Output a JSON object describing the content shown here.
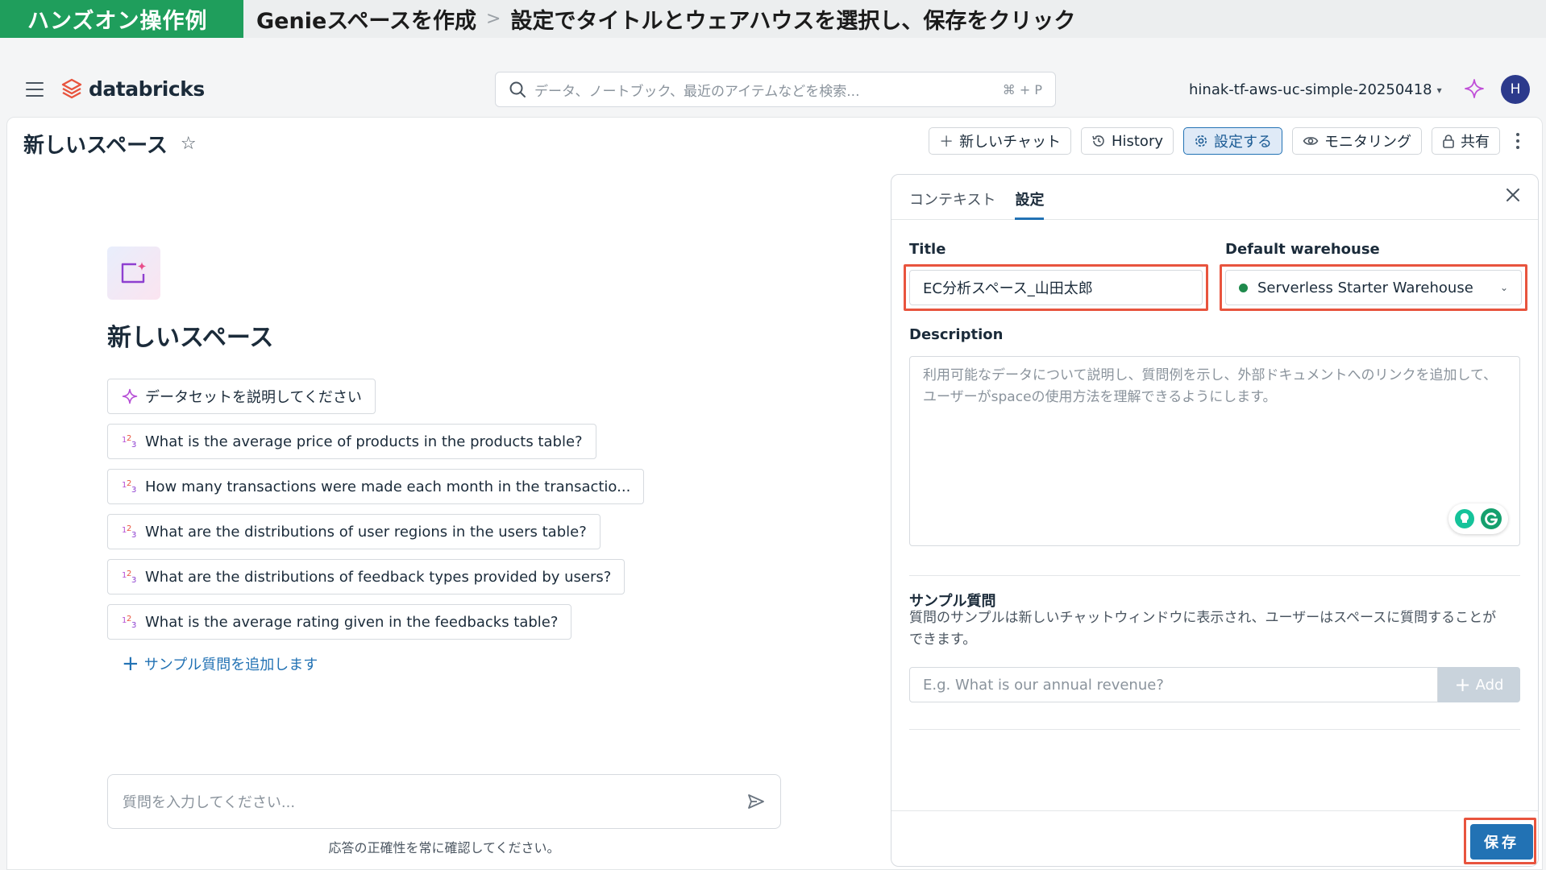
{
  "banner": {
    "tag": "ハンズオン操作例",
    "title": "Genieスペースを作成",
    "separator": ">",
    "step": "設定でタイトルとウェアハウスを選択し、保存をクリック"
  },
  "nav": {
    "logo_text": "databricks",
    "search_placeholder": "データ、ノートブック、最近のアイテムなどを検索...",
    "search_shortcut": "⌘ + P",
    "workspace": "hinak-tf-aws-uc-simple-20250418",
    "avatar_initial": "H"
  },
  "page": {
    "title": "新しいスペース"
  },
  "toolbar": {
    "new_chat": "新しいチャット",
    "history": "History",
    "settings": "設定する",
    "monitoring": "モニタリング",
    "share": "共有"
  },
  "chat": {
    "heading": "新しいスペース",
    "suggestions": [
      "データセットを説明してください",
      "What is the average price of products in the products table?",
      "How many transactions were made each month in the transactio...",
      "What are the distributions of user regions in the users table?",
      "What are the distributions of feedback types provided by users?",
      "What is the average rating given in the feedbacks table?"
    ],
    "add_sample": "サンプル質問を追加します",
    "input_placeholder": "質問を入力してください...",
    "disclaimer": "応答の正確性を常に確認してください。"
  },
  "panel": {
    "tabs": [
      "コンテキスト",
      "設定"
    ],
    "title_label": "Title",
    "title_value": "EC分析スペース_山田太郎",
    "warehouse_label": "Default warehouse",
    "warehouse_value": "Serverless Starter Warehouse",
    "description_label": "Description",
    "description_placeholder": "利用可能なデータについて説明し、質問例を示し、外部ドキュメントへのリンクを追加して、ユーザーがspaceの使用方法を理解できるようにします。",
    "sample_questions_label": "サンプル質問",
    "sample_questions_help": "質問のサンプルは新しいチャットウィンドウに表示され、ユーザーはスペースに質問することができます。",
    "sample_input_placeholder": "E.g. What is our annual revenue?",
    "add_label": "Add",
    "save_label": "保存"
  },
  "colors": {
    "banner_green": "#1f9e5c",
    "accent_blue": "#2272b4",
    "highlight_red": "#e8543e",
    "warehouse_status": "#1f8a4c"
  }
}
